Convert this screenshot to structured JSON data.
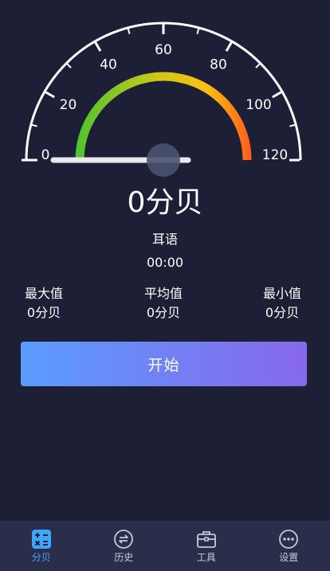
{
  "gauge": {
    "min": 0,
    "max": 120,
    "current_value": 0,
    "labels": [
      "0",
      "20",
      "40",
      "60",
      "80",
      "100",
      "120"
    ],
    "colors": {
      "ring": "#ffffff",
      "low": "#4cc431",
      "mid": "#c8c81a",
      "high": "#ffbf10",
      "max": "#ff5a1e",
      "needle": "#e8e8ee",
      "hub": "#4a5270"
    }
  },
  "reading": "0分贝",
  "level_name": "耳语",
  "timer": "00:00",
  "stats": {
    "max_label": "最大值",
    "max_value": "0分贝",
    "avg_label": "平均值",
    "avg_value": "0分贝",
    "min_label": "最小值",
    "min_value": "0分贝"
  },
  "start_button": "开始",
  "tabbar": {
    "active_color": "#3ea6ff",
    "tabs": [
      {
        "label": "分贝",
        "icon": "calculator-icon",
        "active": true
      },
      {
        "label": "历史",
        "icon": "history-icon",
        "active": false
      },
      {
        "label": "工具",
        "icon": "toolbox-icon",
        "active": false
      },
      {
        "label": "设置",
        "icon": "more-icon",
        "active": false
      }
    ]
  }
}
